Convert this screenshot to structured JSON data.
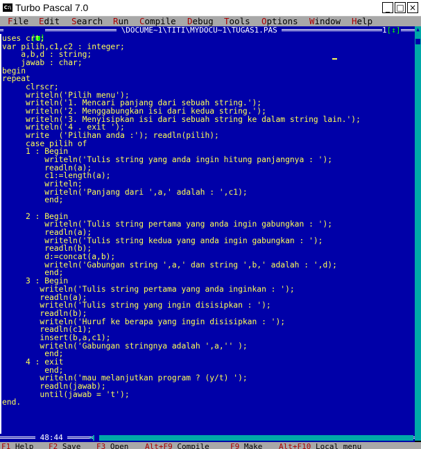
{
  "window": {
    "title": "Turbo Pascal 7.0",
    "icon_label": "C:\\",
    "minimize_label": "_",
    "maximize_label": "□",
    "close_label": "×"
  },
  "menu": [
    {
      "hot": "F",
      "rest": "ile"
    },
    {
      "hot": "E",
      "rest": "dit"
    },
    {
      "hot": "S",
      "rest": "earch"
    },
    {
      "hot": "R",
      "rest": "un"
    },
    {
      "hot": "C",
      "rest": "ompile"
    },
    {
      "hot": "D",
      "rest": "ebug"
    },
    {
      "hot": "T",
      "rest": "ools"
    },
    {
      "hot": "O",
      "rest": "ptions"
    },
    {
      "hot": "W",
      "rest": "indow"
    },
    {
      "hot": "H",
      "rest": "elp"
    }
  ],
  "editor": {
    "close_box": "[■]",
    "file_path": " \\DOCUME~1\\TITI\\MYDOCU~1\\TUGAS1.PAS ",
    "window_number": "1",
    "zoom_box": "[↕]",
    "cursor_position": "48:44",
    "lines": [
      "uses crt;",
      "var pilih,c1,c2 : integer;",
      "    a,b,d : string;",
      "    jawab : char;",
      "begin",
      "repeat",
      "     clrscr;",
      "     writeln('Pilih menu');",
      "     writeln('1. Mencari panjang dari sebuah string.');",
      "     writeln('2. Menggabungkan isi dari kedua string.');",
      "     writeln('3. Menyisipkan isi dari sebuah string ke dalam string lain.');",
      "     writeln('4 . exit ');",
      "     write  ('Pilihan anda :'); readln(pilih);",
      "     case pilih of",
      "     1 : Begin",
      "         writeln('Tulis string yang anda ingin hitung panjangnya : ');",
      "         readln(a);",
      "         c1:=length(a);",
      "         writeln;",
      "         writeln('Panjang dari ',a,' adalah : ',c1);",
      "         end;",
      "",
      "     2 : Begin",
      "         writeln('Tulis string pertama yang anda ingin gabungkan : ');",
      "         readln(a);",
      "         writeln('Tulis string kedua yang anda ingin gabungkan : ');",
      "         readln(b);",
      "         d:=concat(a,b);",
      "         writeln('Gabungan string ',a,' dan string ',b,' adalah : ',d);",
      "         end;",
      "     3 : Begin",
      "        writeln('Tulis string pertama yang anda inginkan : ');",
      "        readln(a);",
      "        writeln('Tulis string yang ingin disisipkan : ');",
      "        readln(b);",
      "        writeln('Huruf ke berapa yang ingin disisipkan : ');",
      "        readln(c1);",
      "        insert(b,a,c1);",
      "        writeln('Gabungan stringnya adalah ',a,'' );",
      "         end;",
      "     4 : exit",
      "         end;",
      "        writeln('mau melanjutkan program ? (y/t) ');",
      "        readln(jawab);",
      "        until(jawab = 't');",
      "end.",
      ""
    ]
  },
  "statusbar": [
    {
      "key": "F1",
      "label": "Help"
    },
    {
      "key": "F2",
      "label": "Save"
    },
    {
      "key": "F3",
      "label": "Open"
    },
    {
      "key": "Alt+F9",
      "label": "Compile"
    },
    {
      "key": "F9",
      "label": "Make"
    },
    {
      "key": "Alt+F10",
      "label": "Local menu"
    }
  ],
  "colors": {
    "editor_bg": "#0000a8",
    "code_text": "#ffff55",
    "menubar_bg": "#a8a8a8",
    "hotkey": "#a80000",
    "scrollbar": "#00a8a8",
    "frame_accent": "#00ff00"
  }
}
